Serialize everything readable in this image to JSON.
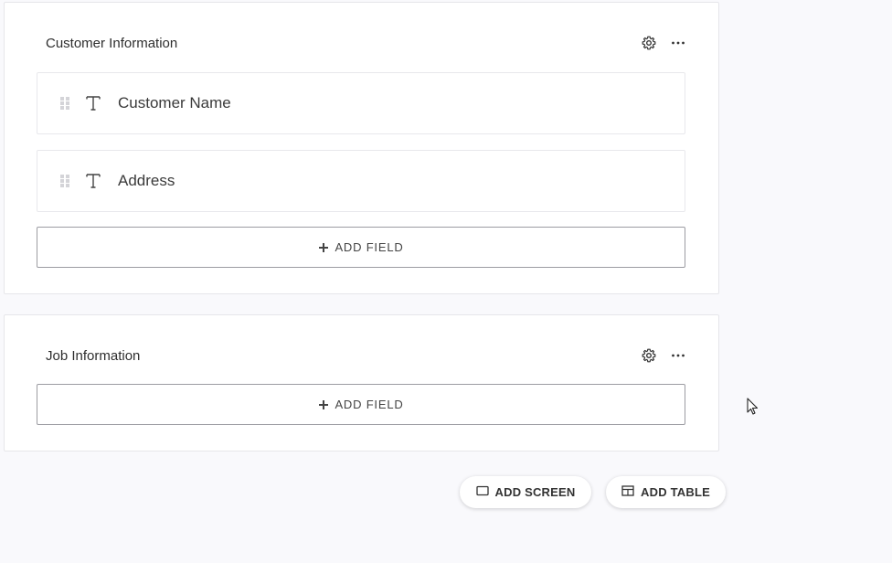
{
  "sections": [
    {
      "title": "Customer Information",
      "fields": [
        {
          "label": "Customer Name",
          "type_icon": "text-type-icon"
        },
        {
          "label": "Address",
          "type_icon": "text-type-icon"
        }
      ],
      "add_field_label": "ADD FIELD"
    },
    {
      "title": "Job Information",
      "fields": [],
      "add_field_label": "ADD FIELD"
    }
  ],
  "footer": {
    "add_screen_label": "ADD SCREEN",
    "add_table_label": "ADD TABLE"
  },
  "colors": {
    "background": "#f9f9fc",
    "card": "#ffffff",
    "border": "#e6e6ea",
    "button_border": "#9c9ca2",
    "text": "#333333"
  },
  "icons": [
    "gear-icon",
    "more-horizontal-icon",
    "drag-handle-icon",
    "text-type-icon",
    "plus-icon",
    "screen-icon",
    "table-icon",
    "mouse-cursor-icon"
  ]
}
